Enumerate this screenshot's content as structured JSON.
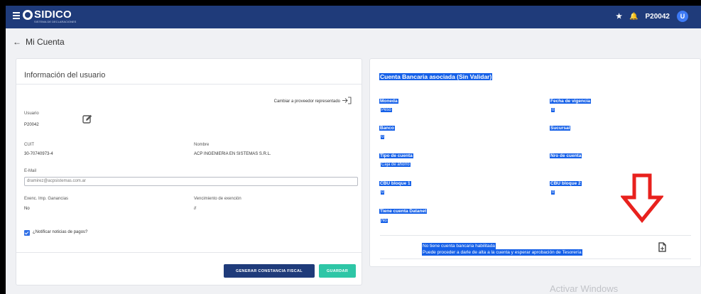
{
  "header": {
    "brand": "SIDICO",
    "brand_subtitle": "SISTEMA DE DECLARACIONES",
    "username": "P20042",
    "avatar_initial": "U",
    "icons": [
      "menu-icon",
      "star-icon",
      "bell-icon"
    ]
  },
  "breadcrumb": {
    "back_icon": "arrow-left-icon",
    "label": "Mi Cuenta"
  },
  "user_info": {
    "title": "Información del usuario",
    "switch_link": "Cambiar a proveedor representado",
    "usuario_label": "Usuario",
    "usuario_value": "P20042",
    "cuit_label": "CUIT",
    "cuit_value": "30-70740973-4",
    "nombre_label": "Nombre",
    "nombre_value": "ACP INGENIERIA EN SISTEMAS S.R.L.",
    "email_label": "E-Mail",
    "email_value": "dramirez@acpsistemas.com.ar",
    "exenc_label": "Exenc. Imp. Ganancias",
    "exenc_value": "No",
    "venc_label": "Vencimiento de exención",
    "venc_value": "//",
    "notify_label": "¿Notificar noticias de pagos?",
    "notify_checked": true,
    "btn_constancia": "GENERAR CONSTANCIA FISCAL",
    "btn_guardar": "GUARDAR"
  },
  "bank_account": {
    "title": "Cuenta Bancaria asociada (Sin Validar)",
    "moneda_label": "Moneda",
    "moneda_value": "Peso",
    "fecha_label": "Fecha de vigencia",
    "fecha_value": "0",
    "banco_label": "Banco",
    "banco_value": "0",
    "sucursal_label": "Sucursal",
    "tipo_label": "Tipo de cuenta",
    "tipo_value": "Caja de ahorro",
    "nro_label": "Nro de cuenta",
    "cbu1_label": "CBU bloque 1",
    "cbu1_value": "0",
    "cbu2_label": "CBU bloque 2",
    "cbu2_value": "0",
    "datanet_label": "Tiene cuenta Datanet",
    "datanet_value": "No",
    "message_line1": "No tiene cuenta bancaria habilitada",
    "message_line2": "Puede proceder a darle de alta a la cuenta y esperar aprobación de Tesorería",
    "highlight_color": "#1560e8"
  },
  "watermark": "Activar Windows",
  "colors": {
    "header_bg": "#1f3b7a",
    "primary_button": "#1f3b7a",
    "save_button": "#2ec6a6",
    "annotation_arrow": "#e8211d"
  }
}
